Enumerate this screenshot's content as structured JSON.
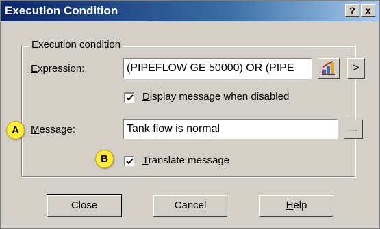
{
  "dialog": {
    "title": "Execution Condition",
    "help_glyph": "?",
    "close_glyph": "x"
  },
  "group": {
    "title": "Execution condition"
  },
  "expression": {
    "label_mnemonic": "E",
    "label_rest": "xpression:",
    "value": "(PIPEFLOW  GE 50000) OR (PIPE",
    "more_glyph": ">",
    "builder_icon": "expression-builder-icon"
  },
  "display_disabled": {
    "checked": true,
    "label_mnemonic": "D",
    "label_rest": "isplay message when disabled"
  },
  "message": {
    "label_mnemonic": "M",
    "label_rest": "essage:",
    "value": "Tank flow is normal",
    "browse_glyph": "..."
  },
  "translate": {
    "checked": true,
    "label_mnemonic": "T",
    "label_rest": "ranslate message"
  },
  "callouts": {
    "a": "A",
    "b": "B"
  },
  "buttons": {
    "close": "Close",
    "cancel": "Cancel",
    "help_mnemonic": "H",
    "help_rest": "elp"
  }
}
